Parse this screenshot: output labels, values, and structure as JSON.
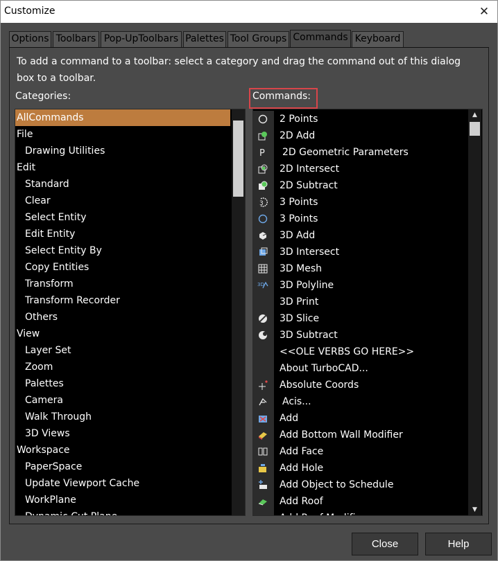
{
  "window": {
    "title": "Customize",
    "close_glyph": "✕"
  },
  "tabs": [
    {
      "label": "Options",
      "active": false
    },
    {
      "label": "Toolbars",
      "active": false
    },
    {
      "label": "Pop-UpToolbars",
      "active": false
    },
    {
      "label": "Palettes",
      "active": false
    },
    {
      "label": "Tool Groups",
      "active": false
    },
    {
      "label": "Commands",
      "active": true
    },
    {
      "label": "Keyboard",
      "active": false
    }
  ],
  "description": "To add a command to a toolbar: select a category and drag the command out of this dialog box to a toolbar.",
  "categories": {
    "label": "Categories:",
    "selected": "AllCommands",
    "items": [
      "AllCommands",
      "File",
      "Drawing Utilities",
      "Edit",
      "Standard",
      "Clear",
      "Select Entity",
      "Edit Entity",
      "Select Entity By",
      "Copy Entities",
      "Transform",
      "Transform Recorder",
      "Others",
      "View",
      "Layer Set",
      "Zoom",
      "Palettes",
      "Camera",
      "Walk Through",
      "3D Views",
      "Workspace",
      "PaperSpace",
      "Update Viewport Cache",
      "WorkPlane",
      "Dynamic Cut Plane"
    ]
  },
  "commands": {
    "label": "Commands:",
    "items": [
      {
        "label": "2 Points",
        "icon": "circle-icon"
      },
      {
        "label": "2D Add",
        "icon": "2d-add-icon"
      },
      {
        "label": "2D Geometric Parameters",
        "icon": "parameter-p-icon"
      },
      {
        "label": "2D Intersect",
        "icon": "2d-intersect-icon"
      },
      {
        "label": "2D Subtract",
        "icon": "2d-subtract-icon"
      },
      {
        "label": "3 Points",
        "icon": "arc-3-points-icon"
      },
      {
        "label": "3 Points",
        "icon": "circle-3-points-icon"
      },
      {
        "label": "3D Add",
        "icon": "3d-add-icon"
      },
      {
        "label": "3D Intersect",
        "icon": "3d-intersect-icon"
      },
      {
        "label": "3D Mesh",
        "icon": "mesh-icon"
      },
      {
        "label": "3D Polyline",
        "icon": "3d-polyline-icon"
      },
      {
        "label": "3D Print",
        "icon": ""
      },
      {
        "label": "3D Slice",
        "icon": "3d-slice-icon"
      },
      {
        "label": "3D Subtract",
        "icon": "3d-subtract-icon"
      },
      {
        "label": "<<OLE VERBS GO HERE>>",
        "icon": ""
      },
      {
        "label": "About TurboCAD...",
        "icon": ""
      },
      {
        "label": "Absolute Coords",
        "icon": "absolute-coords-icon"
      },
      {
        "label": "Acis...",
        "icon": "acis-icon"
      },
      {
        "label": "Add",
        "icon": "add-icon"
      },
      {
        "label": "Add Bottom Wall Modifier",
        "icon": "wall-modifier-icon"
      },
      {
        "label": "Add Face",
        "icon": "add-face-icon"
      },
      {
        "label": "Add Hole",
        "icon": "add-hole-icon"
      },
      {
        "label": "Add Object to Schedule",
        "icon": "add-schedule-icon"
      },
      {
        "label": "Add Roof",
        "icon": "add-roof-icon"
      },
      {
        "label": "Add Roof Modifier",
        "icon": "roof-modifier-icon"
      }
    ]
  },
  "buttons": {
    "close": "Close",
    "help": "Help"
  },
  "colors": {
    "selection": "#bd7c3e",
    "highlight_box": "#d9454a",
    "dialog_bg": "#4a4a4a",
    "list_bg": "#000000"
  }
}
